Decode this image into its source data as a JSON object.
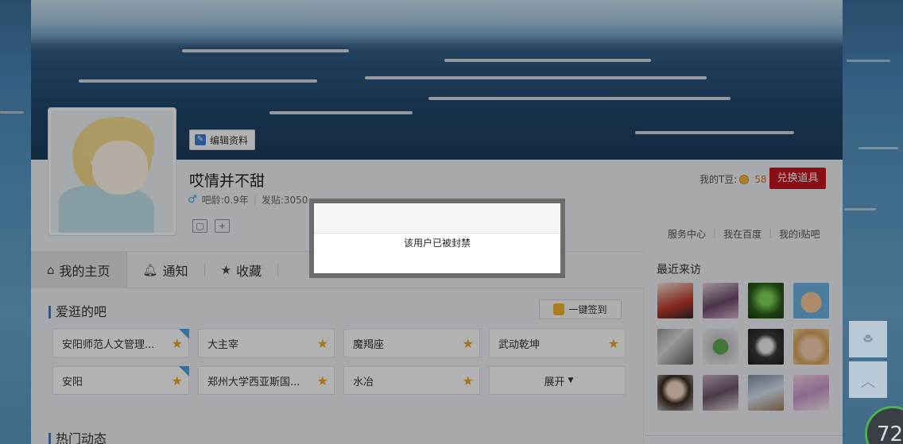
{
  "profile": {
    "edit_label": "编辑资料",
    "username": "哎情并不甜",
    "age_label": "吧龄:0.9年",
    "posts_label": "发贴:3050",
    "tdou_label": "我的T豆:",
    "tdou_value": "58",
    "exchange_label": "兑换道具"
  },
  "top_links": [
    "服务中心",
    "我在百度",
    "我的i贴吧"
  ],
  "tabs": [
    {
      "label": "我的主页",
      "icon": "home-icon"
    },
    {
      "label": "通知",
      "icon": "bell-icon"
    },
    {
      "label": "收藏",
      "icon": "star-icon"
    }
  ],
  "favorites": {
    "title": "爱逛的吧",
    "sign_label": "一键签到",
    "items": [
      "安阳师范人文管理...",
      "大主宰",
      "魔羯座",
      "武动乾坤",
      "安阳",
      "郑州大学西亚斯国...",
      "水冶"
    ],
    "expand_label": "展开"
  },
  "hot_title": "热门动态",
  "visitors_title": "最近来访",
  "modal": {
    "message": "该用户已被封禁"
  },
  "gauge_value": "72",
  "colors": {
    "accent": "#3b7fd1",
    "exchange": "#c8131d",
    "star": "#f0a623"
  }
}
